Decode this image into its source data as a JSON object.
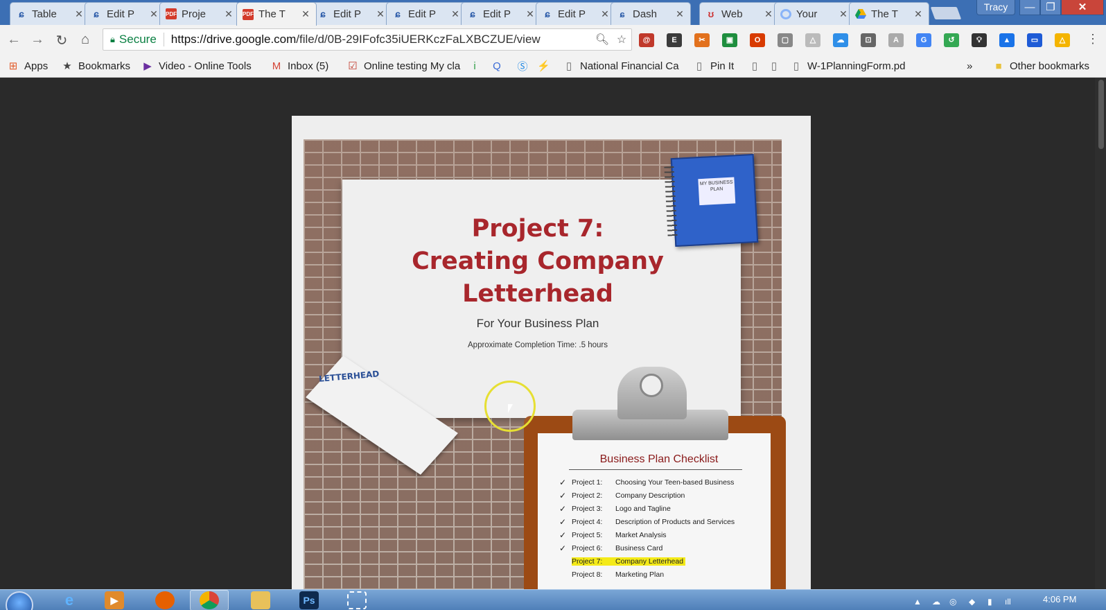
{
  "tabs": [
    {
      "title": "Table",
      "icon": "weebly"
    },
    {
      "title": "Edit P",
      "icon": "weebly"
    },
    {
      "title": "Proje",
      "icon": "pdf"
    },
    {
      "title": "The T",
      "icon": "pdf",
      "active": true
    },
    {
      "title": "Edit P",
      "icon": "weebly"
    },
    {
      "title": "Edit P",
      "icon": "weebly"
    },
    {
      "title": "Edit P",
      "icon": "weebly"
    },
    {
      "title": "Edit P",
      "icon": "weebly"
    },
    {
      "title": "Dash",
      "icon": "dash"
    },
    {
      "title": "Web",
      "icon": "web"
    },
    {
      "title": "Your",
      "icon": "circle"
    },
    {
      "title": "The T",
      "icon": "drive"
    }
  ],
  "window": {
    "profile_name": "Tracy",
    "minimize": "—",
    "maximize": "❐",
    "close": "✕"
  },
  "toolbar": {
    "secure_label": "Secure",
    "url_host": "https://drive.google.com",
    "url_path": "/file/d/0B-29IFofc35iUERKczFaLXBCZUE/view"
  },
  "bookmarks": {
    "items": [
      {
        "label": "Apps",
        "icon": "apps-grid"
      },
      {
        "label": "Bookmarks",
        "icon": "star"
      },
      {
        "label": "Video - Online Tools",
        "icon": "video-tools"
      },
      {
        "label": "Inbox (5)",
        "icon": "gmail"
      },
      {
        "label": "Online testing My cla",
        "icon": "checkbox"
      },
      {
        "label": "",
        "icon": "info"
      },
      {
        "label": "",
        "icon": "quizlet"
      },
      {
        "label": "",
        "icon": "s-circle"
      },
      {
        "label": "",
        "icon": "bolt"
      },
      {
        "label": "National Financial Ca",
        "icon": "page"
      },
      {
        "label": "Pin It",
        "icon": "page"
      },
      {
        "label": "",
        "icon": "page"
      },
      {
        "label": "",
        "icon": "page"
      },
      {
        "label": "W-1PlanningForm.pd",
        "icon": "page"
      }
    ],
    "overflow": "»",
    "other": "Other bookmarks"
  },
  "document": {
    "title_lines": [
      "Project 7:",
      "Creating Company",
      "Letterhead"
    ],
    "subtitle": "For Your Business Plan",
    "time": "Approximate Completion Time: .5 hours",
    "notebook_label": "MY BUSINESS PLAN",
    "letterhead_card": "LETTERHEAD",
    "checklist_title": "Business Plan Checklist",
    "checklist": [
      {
        "check": "✓",
        "project": "Project 1:",
        "name": "Choosing Your Teen-based Business"
      },
      {
        "check": "✓",
        "project": "Project 2:",
        "name": "Company Description"
      },
      {
        "check": "✓",
        "project": "Project 3:",
        "name": "Logo and Tagline"
      },
      {
        "check": "✓",
        "project": "Project 4:",
        "name": "Description of Products and Services"
      },
      {
        "check": "✓",
        "project": "Project 5:",
        "name": "Market Analysis"
      },
      {
        "check": "✓",
        "project": "Project 6:",
        "name": "Business Card"
      },
      {
        "check": "",
        "project": "Project 7:",
        "name": "Company Letterhead",
        "highlight": true
      },
      {
        "check": "",
        "project": "Project 8:",
        "name": "Marketing Plan"
      }
    ]
  },
  "taskbar": {
    "clock": "4:06 PM",
    "ps_label": "Ps"
  },
  "colors": {
    "tabstrip": "#3c6fb4",
    "title_red": "#a8262c",
    "highlight": "#f4ea18",
    "secure_green": "#0b8043"
  }
}
